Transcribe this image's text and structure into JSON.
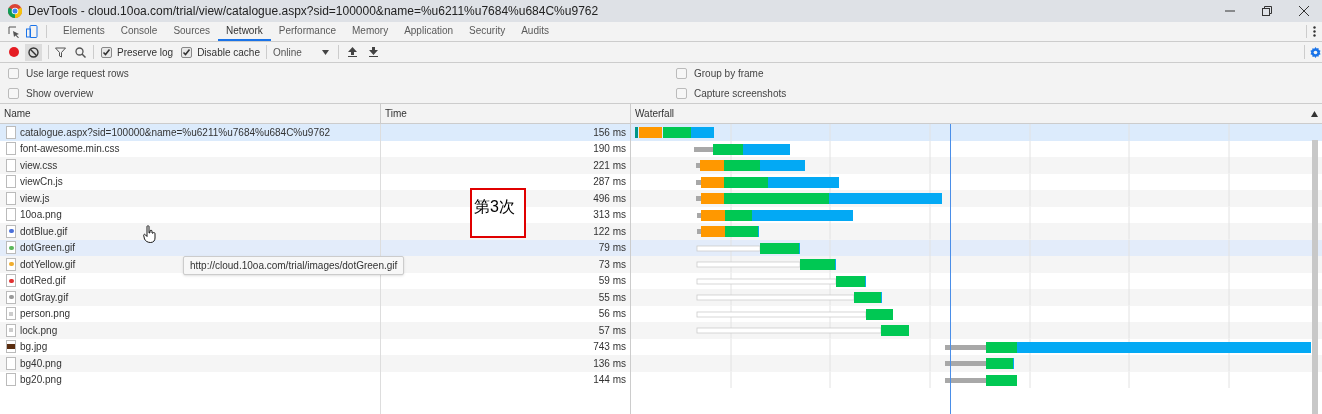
{
  "window": {
    "title": "DevTools - cloud.10oa.com/trial/view/catalogue.aspx?sid=100000&name=%u6211%u7684%u684C%u9762"
  },
  "tabs": [
    {
      "label": "Elements",
      "selected": false
    },
    {
      "label": "Console",
      "selected": false
    },
    {
      "label": "Sources",
      "selected": false
    },
    {
      "label": "Network",
      "selected": true
    },
    {
      "label": "Performance",
      "selected": false
    },
    {
      "label": "Memory",
      "selected": false
    },
    {
      "label": "Application",
      "selected": false
    },
    {
      "label": "Security",
      "selected": false
    },
    {
      "label": "Audits",
      "selected": false
    }
  ],
  "toolbar": {
    "recording": true,
    "preserve_log": {
      "label": "Preserve log",
      "checked": true
    },
    "disable_cache": {
      "label": "Disable cache",
      "checked": true
    },
    "throttling": "Online"
  },
  "settings": [
    {
      "label": "Use large request rows",
      "checked": false
    },
    {
      "label": "Group by frame",
      "checked": false
    },
    {
      "label": "Show overview",
      "checked": false
    },
    {
      "label": "Capture screenshots",
      "checked": false
    }
  ],
  "table": {
    "columns": [
      "Name",
      "Time",
      "Waterfall"
    ],
    "rows": [
      {
        "name": "catalogue.aspx?sid=100000&name=%u6211%u7684%u684C%u9762",
        "time": "156 ms",
        "kind": "doc",
        "selected": true,
        "hovered": false
      },
      {
        "name": "font-awesome.min.css",
        "time": "190 ms",
        "kind": "doc",
        "selected": false,
        "hovered": false
      },
      {
        "name": "view.css",
        "time": "221 ms",
        "kind": "doc",
        "selected": false,
        "hovered": false
      },
      {
        "name": "viewCn.js",
        "time": "287 ms",
        "kind": "doc",
        "selected": false,
        "hovered": false
      },
      {
        "name": "view.js",
        "time": "496 ms",
        "kind": "doc",
        "selected": false,
        "hovered": false
      },
      {
        "name": "10oa.png",
        "time": "313 ms",
        "kind": "doc",
        "selected": false,
        "hovered": false
      },
      {
        "name": "dotBlue.gif",
        "time": "122 ms",
        "kind": "dot",
        "color": "#4a6fd8",
        "selected": false,
        "hovered": false
      },
      {
        "name": "dotGreen.gif",
        "time": "79 ms",
        "kind": "dot",
        "color": "#5cb85c",
        "selected": false,
        "hovered": true
      },
      {
        "name": "dotYellow.gif",
        "time": "73 ms",
        "kind": "dot",
        "color": "#f0ad2e",
        "selected": false,
        "hovered": false
      },
      {
        "name": "dotRed.gif",
        "time": "59 ms",
        "kind": "dot",
        "color": "#e03030",
        "selected": false,
        "hovered": false
      },
      {
        "name": "dotGray.gif",
        "time": "55 ms",
        "kind": "dot",
        "color": "#999999",
        "selected": false,
        "hovered": false
      },
      {
        "name": "person.png",
        "time": "56 ms",
        "kind": "image",
        "selected": false,
        "hovered": false
      },
      {
        "name": "lock.png",
        "time": "57 ms",
        "kind": "image",
        "selected": false,
        "hovered": false
      },
      {
        "name": "bg.jpg",
        "time": "743 ms",
        "kind": "photo",
        "selected": false,
        "hovered": false
      },
      {
        "name": "bg40.png",
        "time": "136 ms",
        "kind": "doc",
        "selected": false,
        "hovered": false
      },
      {
        "name": "bg20.png",
        "time": "144 ms",
        "kind": "doc",
        "selected": false,
        "hovered": false
      }
    ]
  },
  "tooltip": "http://cloud.10oa.com/trial/images/dotGreen.gif",
  "annotation": "第3次"
}
